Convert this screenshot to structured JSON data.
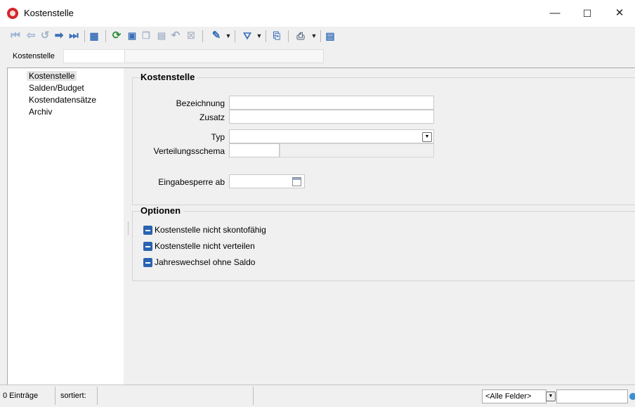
{
  "window": {
    "title": "Kostenstelle",
    "controls": {
      "minimize": "—",
      "maximize": "☐",
      "close": "✕"
    }
  },
  "toolbar": {
    "icons": [
      "first-record-icon",
      "prev-record-icon",
      "undo-icon",
      "next-record-icon",
      "last-record-icon",
      "table-view-icon",
      "refresh-icon",
      "new-record-icon",
      "copy-record-icon",
      "save-icon",
      "cancel-icon",
      "delete-icon",
      "pin-icon",
      "filter-icon",
      "select-icon",
      "print-icon",
      "calculator-icon"
    ]
  },
  "search": {
    "label": "Kostenstelle",
    "value": ""
  },
  "nav": {
    "items": [
      {
        "label": "Kostenstelle",
        "selected": true
      },
      {
        "label": "Salden/Budget",
        "selected": false
      },
      {
        "label": "Kostendatensätze",
        "selected": false
      },
      {
        "label": "Archiv",
        "selected": false
      }
    ]
  },
  "form": {
    "section_title": "Kostenstelle",
    "bezeichnung_label": "Bezeichnung",
    "bezeichnung_value": "",
    "zusatz_label": "Zusatz",
    "zusatz_value": "",
    "typ_label": "Typ",
    "typ_value": "",
    "verteilungsschema_label": "Verteilungsschema",
    "verteilungsschema_value": "",
    "eingabesperre_label": "Eingabesperre ab",
    "eingabesperre_value": ""
  },
  "options": {
    "section_title": "Optionen",
    "items": [
      {
        "label": "Kostenstelle nicht skontofähig",
        "checked": "indeterminate"
      },
      {
        "label": "Kostenstelle nicht verteilen",
        "checked": "indeterminate"
      },
      {
        "label": "Jahreswechsel ohne Saldo",
        "checked": "indeterminate"
      }
    ]
  },
  "status": {
    "count": "0 Einträge",
    "sorted_label": "sortiert:",
    "sorted_value": "",
    "field_filter": "<Alle Felder>",
    "filter_value": ""
  },
  "colors": {
    "accent": "#2a63b0",
    "nav_selected": "#e4e4e4",
    "icon_blue": "#3a6fb8",
    "icon_green": "#2e8b3a"
  }
}
